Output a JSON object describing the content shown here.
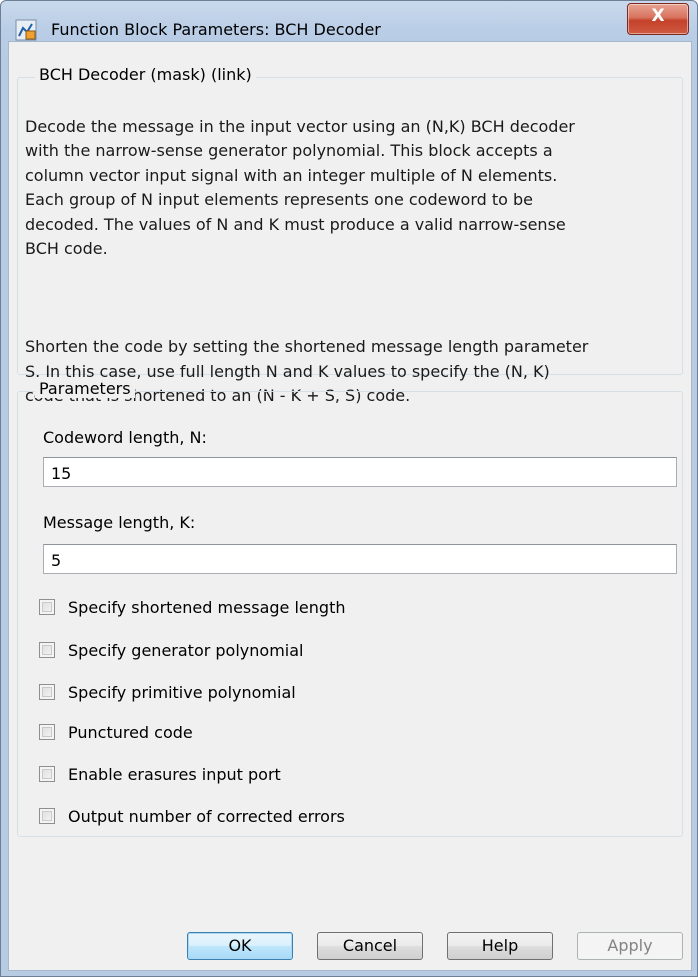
{
  "window": {
    "title": "Function Block Parameters: BCH Decoder",
    "close_label": "X"
  },
  "description": {
    "legend": "BCH Decoder (mask) (link)",
    "paragraph1": "Decode the message in the input vector using an (N,K) BCH decoder\nwith the narrow-sense generator polynomial.  This block accepts a\ncolumn vector input signal with an integer multiple of N elements.\nEach group of N input elements represents one codeword to be\ndecoded.  The values of N and K must produce a valid narrow-sense\nBCH code.",
    "paragraph2": "Shorten the code by setting the shortened message length parameter\nS. In this case, use full length N and K values to specify the (N, K)\ncode that is shortened to an (N - K + S, S) code."
  },
  "parameters": {
    "legend": "Parameters",
    "codeword_length": {
      "label": "Codeword length, N:",
      "value": "15"
    },
    "message_length": {
      "label": "Message length, K:",
      "value": "5"
    },
    "checkboxes": [
      {
        "label": "Specify shortened message length",
        "checked": false
      },
      {
        "label": "Specify generator polynomial",
        "checked": false
      },
      {
        "label": "Specify primitive polynomial",
        "checked": false
      },
      {
        "label": "Punctured code",
        "checked": false
      },
      {
        "label": "Enable erasures input port",
        "checked": false
      },
      {
        "label": "Output number of corrected errors",
        "checked": false
      }
    ]
  },
  "buttons": {
    "ok": "OK",
    "cancel": "Cancel",
    "help": "Help",
    "apply": "Apply"
  },
  "colors": {
    "titlebar": "#b9cde6",
    "client_background": "#f0f0f0",
    "close_button": "#c4412a",
    "default_button_border": "#3c7fb1"
  }
}
